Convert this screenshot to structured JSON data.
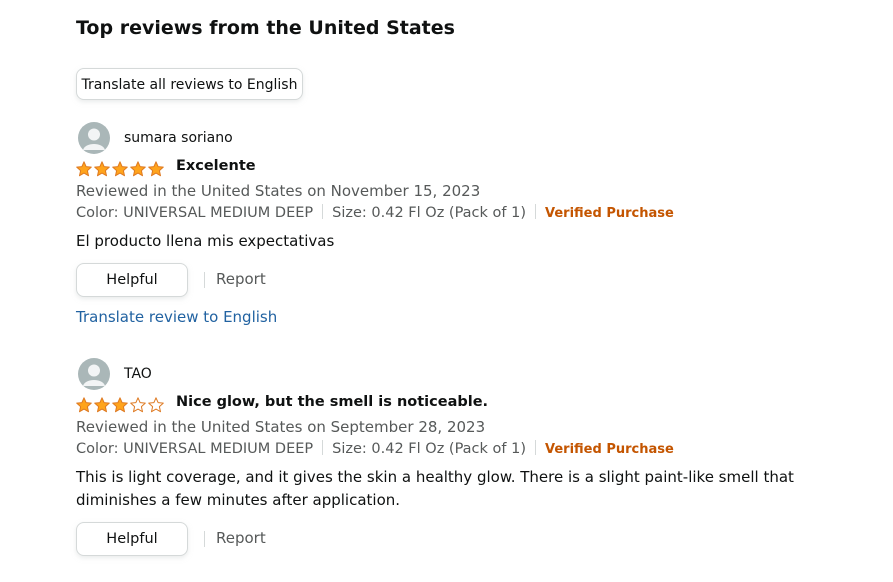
{
  "section": {
    "title": "Top reviews from the United States",
    "translate_all_label": "Translate all reviews to English"
  },
  "reviews": [
    {
      "author": "sumara soriano",
      "rating": 5,
      "rating_max": 5,
      "title": "Excelente",
      "date_line": "Reviewed in the United States on November 15, 2023",
      "color": "Color: UNIVERSAL MEDIUM DEEP",
      "size": "Size: 0.42 Fl Oz (Pack of 1)",
      "verified": "Verified Purchase",
      "body": "El producto llena mis expectativas",
      "helpful_label": "Helpful",
      "report_label": "Report",
      "translate_label": "Translate review to English"
    },
    {
      "author": "TAO",
      "rating": 3,
      "rating_max": 5,
      "title": "Nice glow, but the smell is noticeable.",
      "date_line": "Reviewed in the United States on September 28, 2023",
      "color": "Color: UNIVERSAL MEDIUM DEEP",
      "size": "Size: 0.42 Fl Oz (Pack of 1)",
      "verified": "Verified Purchase",
      "body": "This is light coverage, and it gives the skin a healthy glow. There is a slight paint-like smell that diminishes a few minutes after application.",
      "helpful_label": "Helpful",
      "report_label": "Report"
    }
  ],
  "colors": {
    "star_fill": "#ffa41c",
    "star_stroke": "#de7921",
    "verified": "#c45500",
    "link": "#2162a1",
    "avatar_bg": "#aab7b8"
  },
  "icons": {
    "avatar": "user-silhouette-icon",
    "star_full": "star-filled-icon",
    "star_empty": "star-outline-icon"
  }
}
